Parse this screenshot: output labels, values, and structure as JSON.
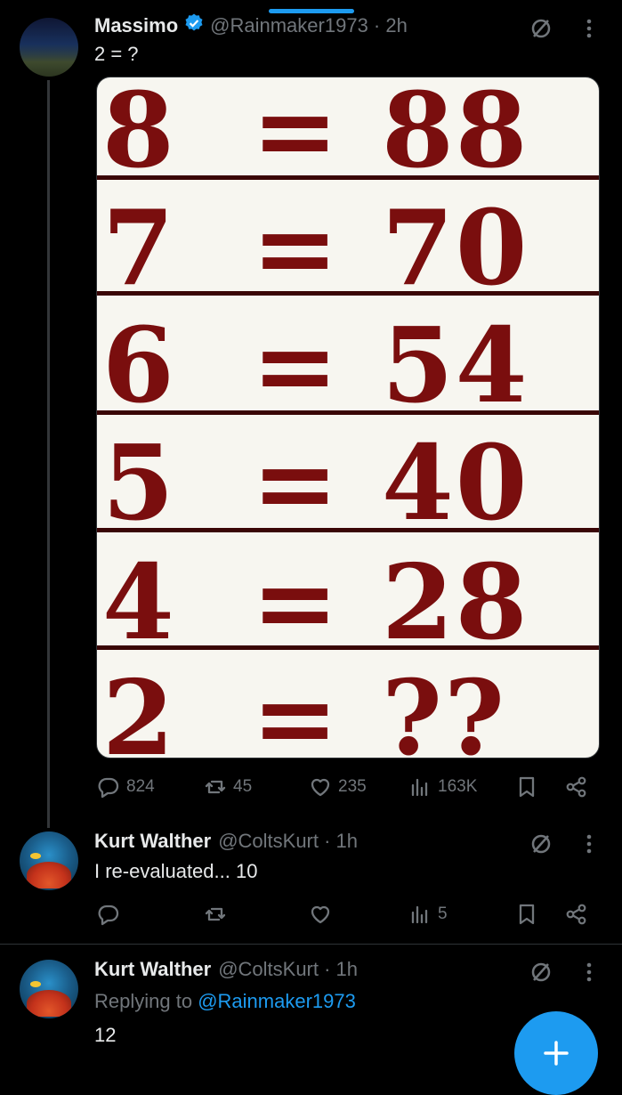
{
  "tweet1": {
    "name": "Massimo",
    "handle_time": "@Rainmaker1973 · 2h",
    "text": "2 = ?",
    "meme_rows": [
      {
        "lhs": "8",
        "eq": "=",
        "rhs": "88"
      },
      {
        "lhs": "7",
        "eq": "=",
        "rhs": "70"
      },
      {
        "lhs": "6",
        "eq": "=",
        "rhs": "54"
      },
      {
        "lhs": "5",
        "eq": "=",
        "rhs": "40"
      },
      {
        "lhs": "4",
        "eq": "=",
        "rhs": "28"
      },
      {
        "lhs": "2",
        "eq": "=",
        "rhs": "??"
      }
    ],
    "replies": "824",
    "reposts": "45",
    "likes": "235",
    "views": "163K"
  },
  "tweet2": {
    "name": "Kurt Walther",
    "handle_time": "@ColtsKurt · 1h",
    "text": "I re-evaluated... 10",
    "views": "5"
  },
  "tweet3": {
    "name": "Kurt Walther",
    "handle_time": "@ColtsKurt · 1h",
    "replying_prefix": "Replying to",
    "replying_handle": "@Rainmaker1973",
    "text": "12"
  },
  "colors": {
    "accent": "#1d9bf0",
    "meme_text": "#7a0e0e",
    "muted": "#71767b"
  },
  "icons": [
    "verified-badge-icon",
    "grok-icon",
    "more-icon",
    "reply-icon",
    "repost-icon",
    "like-icon",
    "views-icon",
    "bookmark-icon",
    "share-icon",
    "compose-icon"
  ]
}
